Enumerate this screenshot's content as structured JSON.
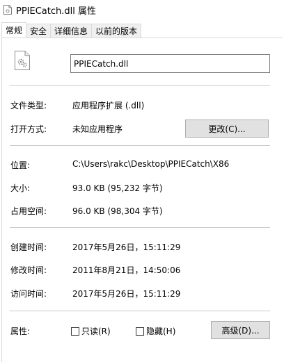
{
  "window": {
    "title": "PPIECatch.dll 属性"
  },
  "tabs": [
    {
      "label": "常规"
    },
    {
      "label": "安全"
    },
    {
      "label": "详细信息"
    },
    {
      "label": "以前的版本"
    }
  ],
  "general": {
    "file_name": "PPIECatch.dll",
    "file_type_label": "文件类型:",
    "file_type_value": "应用程序扩展 (.dll)",
    "opens_with_label": "打开方式:",
    "opens_with_value": "未知应用程序",
    "change_button": "更改(C)...",
    "location_label": "位置:",
    "location_value": "C:\\Users\\rakc\\Desktop\\PPIECatch\\X86",
    "size_label": "大小:",
    "size_value": "93.0 KB (95,232 字节)",
    "size_on_disk_label": "占用空间:",
    "size_on_disk_value": "96.0 KB (98,304 字节)",
    "created_label": "创建时间:",
    "created_value": "2017年5月26日，15:11:29",
    "modified_label": "修改时间:",
    "modified_value": "2011年8月21日，14:50:06",
    "accessed_label": "访问时间:",
    "accessed_value": "2017年5月26日，15:11:29",
    "attributes_label": "属性:",
    "readonly_label": "只读(R)",
    "readonly_checked": false,
    "hidden_label": "隐藏(H)",
    "hidden_checked": false,
    "advanced_button": "高级(D)..."
  },
  "icons": {
    "title": "dll-file-icon",
    "file": "dll-file-gear-icon"
  }
}
